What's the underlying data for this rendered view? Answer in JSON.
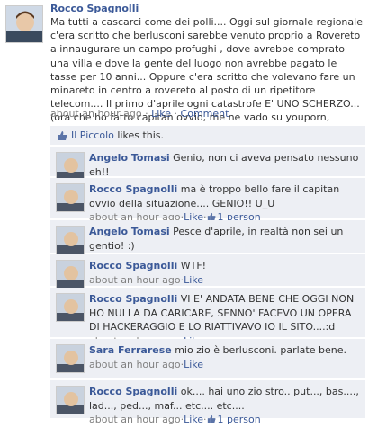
{
  "post": {
    "author": "Rocco Spagnolli",
    "text": "Ma tutti a cascarci come dei polli.... Oggi sul giornale regionale c'era scritto che berlusconi sarebbe venuto proprio a Rovereto a innaugurare un campo profughi , dove avrebbe comprato una villa e dove la gente del luogo non avrebbe pagato le tasse per 10 anni... Oppure c'era scritto che volevano fare un minareto in centro a rovereto al posto di un ripetitore telecom.... Il primo d'aprile ogni catastrofe E' UNO SCHERZO... (ora che ho fatto capitan ovvio, me ne vado su youporn, sempre che la polizia postale non l'abbia oscurato...)",
    "time": "about an hour ago",
    "sep": "·",
    "like_label": "Like",
    "comment_label": "Comment"
  },
  "likes": {
    "name": "Il Piccolo",
    "suffix": " likes this."
  },
  "comments": [
    {
      "author": "Angelo Tomasi",
      "text": "Genio, non ci aveva pensato nessuno eh!!",
      "time": "about an hour ago",
      "like": "Like",
      "likes_count": ""
    },
    {
      "author": "Rocco Spagnolli",
      "text": "ma è troppo bello fare il capitan ovvio della situazione.... GENIO!! U_U",
      "time": "about an hour ago",
      "like": "Like",
      "likes_count": "1 person"
    },
    {
      "author": "Angelo Tomasi",
      "text": "Pesce d'aprile, in realtà non sei un gentio! :)",
      "time": "about an hour ago",
      "like": "Like",
      "likes_count": ""
    },
    {
      "author": "Rocco Spagnolli",
      "text": "WTF!",
      "time": "about an hour ago",
      "like": "Like",
      "likes_count": ""
    },
    {
      "author": "Rocco Spagnolli",
      "text": "VI E' ANDATA BENE CHE OGGI NON HO NULLA DA CARICARE, SENNO' FACEVO UN OPERA DI HACKERAGGIO E LO RIATTIVAVO IO IL SITO....:d",
      "time": "about an hour ago",
      "like": "Like",
      "likes_count": ""
    },
    {
      "author": "Sara Ferrarese",
      "text": "mio zio è berlusconi. parlate bene.",
      "time": "about an hour ago",
      "like": "Like",
      "likes_count": ""
    },
    {
      "author": "Rocco Spagnolli",
      "text": "ok.... hai uno zio stro.. put..., bas...., lad..., ped..., maf... etc.... etc....",
      "time": "about an hour ago",
      "like": "Like",
      "likes_count": "1 person"
    }
  ],
  "colors": {
    "link": "#3b5998",
    "comment_bg": "#edeff4",
    "meta": "#808080"
  }
}
